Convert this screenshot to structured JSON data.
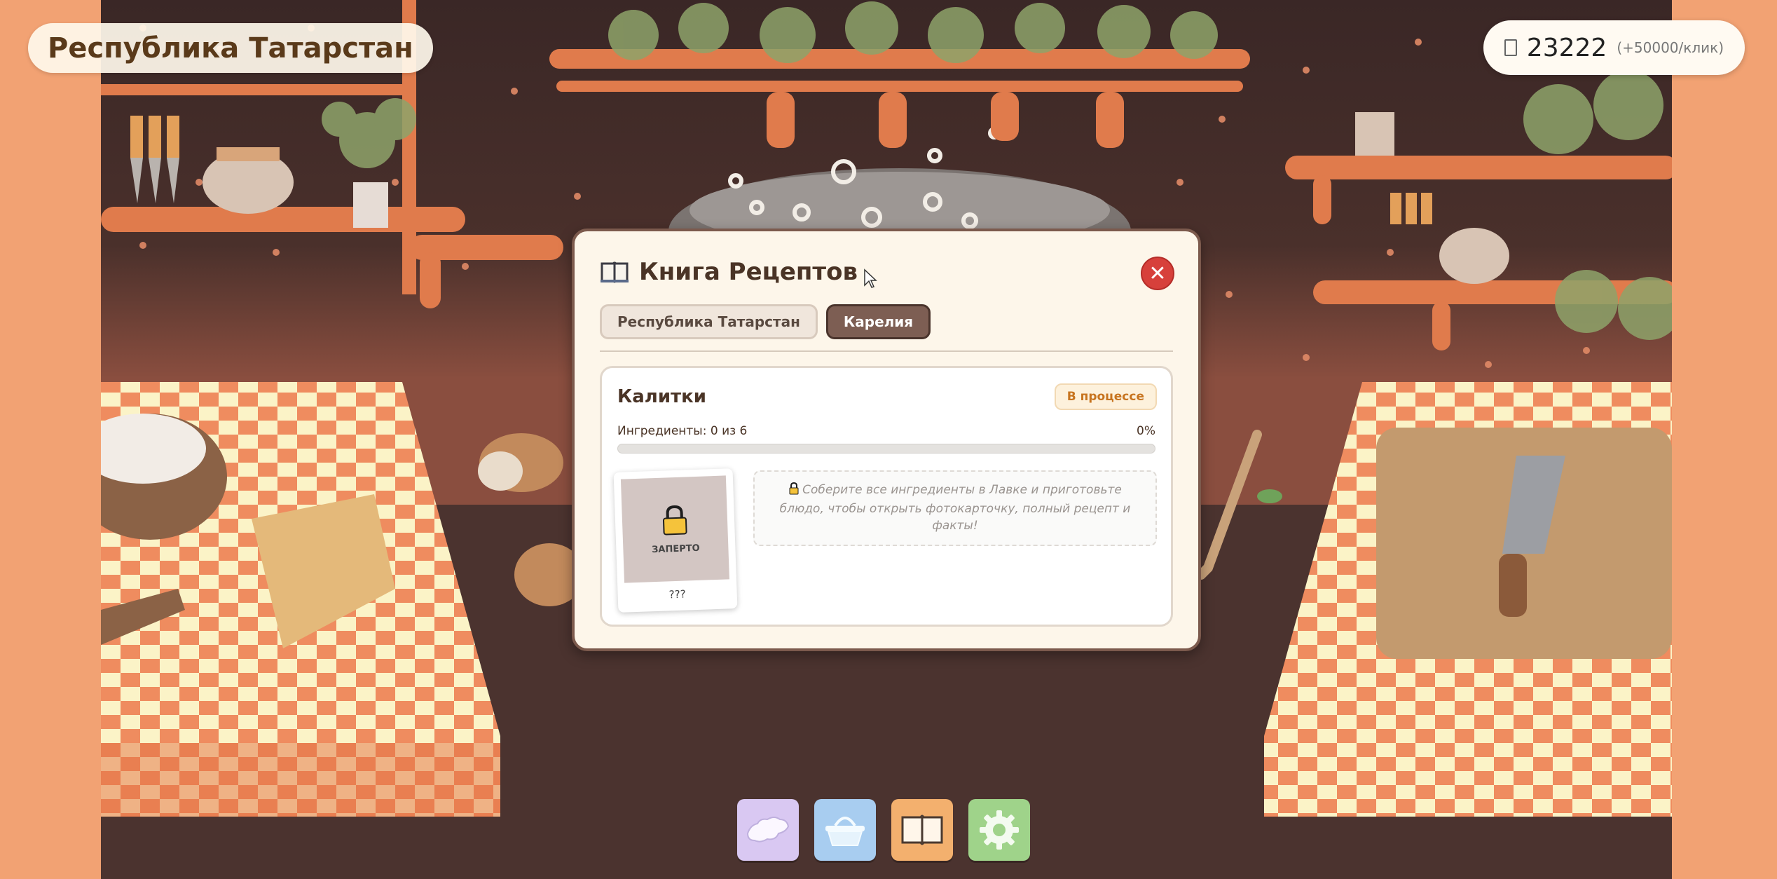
{
  "location_label": "Республика Татарстан",
  "coins": {
    "icon": "coin-icon",
    "amount": "23222",
    "rate": "(+50000/клик)"
  },
  "modal": {
    "title": "Книга Рецептов",
    "close_icon": "close-icon",
    "tabs": [
      {
        "label": "Республика Татарстан",
        "active": false
      },
      {
        "label": "Карелия",
        "active": true
      }
    ],
    "recipe": {
      "name": "Калитки",
      "status": "В процессе",
      "ingredients_label": "Ингредиенты: 0 из 6",
      "progress_label": "0%",
      "progress_fraction": 0,
      "locked_text": "ЗАПЕРТО",
      "card_caption": "???",
      "hint": "Соберите все ингредиенты в Лавке и приготовьте блюдо, чтобы открыть фотокарточку, полный рецепт и факты!"
    }
  },
  "toolbar": [
    {
      "icon": "map-icon"
    },
    {
      "icon": "basket-icon"
    },
    {
      "icon": "book-icon"
    },
    {
      "icon": "gear-icon"
    }
  ],
  "colors": {
    "background": "#f2a273",
    "modal_border": "#7c5a4d",
    "close_button": "#d7403b",
    "active_tab": "#7d5e53",
    "status_text": "#c7741f"
  }
}
